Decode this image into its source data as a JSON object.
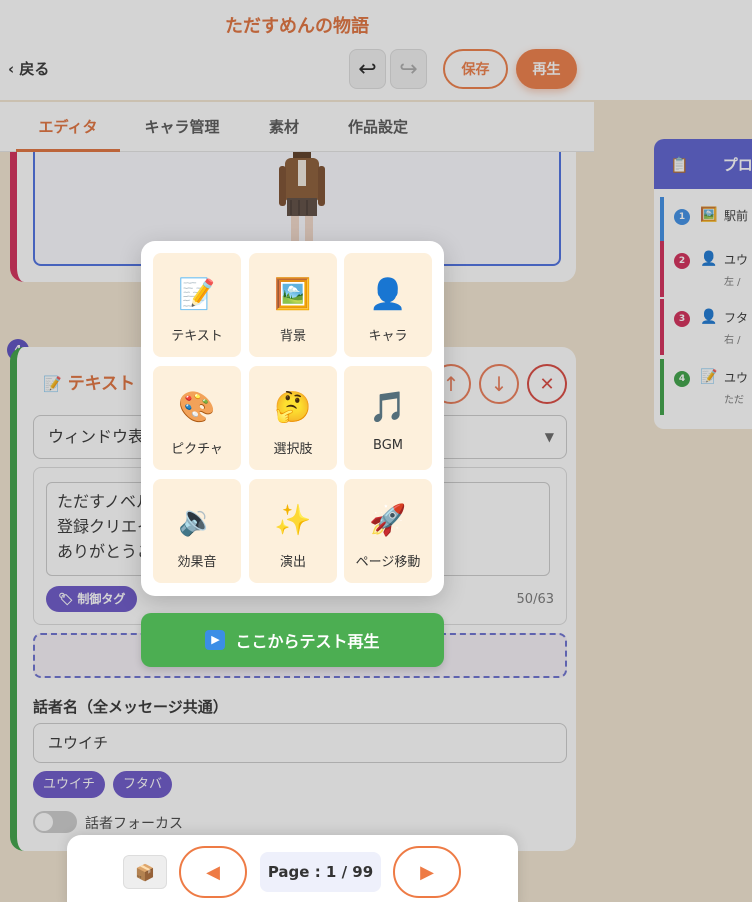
{
  "header": {
    "title": "ただすめんの物語",
    "back_label": "‹ 戻る",
    "undo_icon": "↩",
    "redo_icon": "↪",
    "save_label": "保存",
    "play_label": "再生"
  },
  "tabs": [
    {
      "label": "エディタ",
      "active": true
    },
    {
      "label": "キャラ管理",
      "active": false
    },
    {
      "label": "素材",
      "active": false
    },
    {
      "label": "作品設定",
      "active": false
    }
  ],
  "text_card": {
    "step": "4",
    "icon": "📝",
    "title": "テキスト",
    "up_icon": "↑",
    "down_icon": "↓",
    "delete_icon": "✕",
    "window_select_value": "ウィンドウ表",
    "message": "ただすノベル\n登録クリエイ\nありがとうご",
    "control_tag_label": "🏷 制御タグ",
    "char_count": "50/63",
    "speaker_label": "話者名（全メッセージ共通）",
    "speaker_value": "ユウイチ",
    "speaker_chips": [
      "ユウイチ",
      "フタバ"
    ],
    "focus_toggle_label": "話者フォーカス"
  },
  "side_panel": {
    "icon": "📋",
    "title": "プロ",
    "items": [
      {
        "num": "1",
        "icon": "🖼️",
        "name": "駅前",
        "sub": "",
        "color": "#3b8ee6"
      },
      {
        "num": "2",
        "icon": "👤",
        "name": "ユウ",
        "sub": "左 /",
        "color": "#d22a56"
      },
      {
        "num": "3",
        "icon": "👤",
        "name": "フタ",
        "sub": "右 /",
        "color": "#d22a56"
      },
      {
        "num": "4",
        "icon": "📝",
        "name": "ユウ",
        "sub": "ただ",
        "color": "#3aa045"
      }
    ]
  },
  "popup": {
    "items": [
      {
        "icon": "📝",
        "label": "テキスト"
      },
      {
        "icon": "🖼️",
        "label": "背景"
      },
      {
        "icon": "👤",
        "label": "キャラ"
      },
      {
        "icon": "🎨",
        "label": "ピクチャ"
      },
      {
        "icon": "🤔",
        "label": "選択肢"
      },
      {
        "icon": "🎵",
        "label": "BGM"
      },
      {
        "icon": "🔉",
        "label": "効果音"
      },
      {
        "icon": "✨",
        "label": "演出"
      },
      {
        "icon": "🚀",
        "label": "ページ移動"
      }
    ]
  },
  "test_play": {
    "icon": "▶",
    "label": "ここからテスト再生"
  },
  "pager": {
    "package_icon": "📦",
    "prev_icon": "◀",
    "next_icon": "▶",
    "label": "Page : 1 / 99"
  },
  "colors": {
    "accent": "#ee7b45",
    "purple": "#6a55c8",
    "green": "#4cae52",
    "panel_head": "#5a5fd0"
  }
}
